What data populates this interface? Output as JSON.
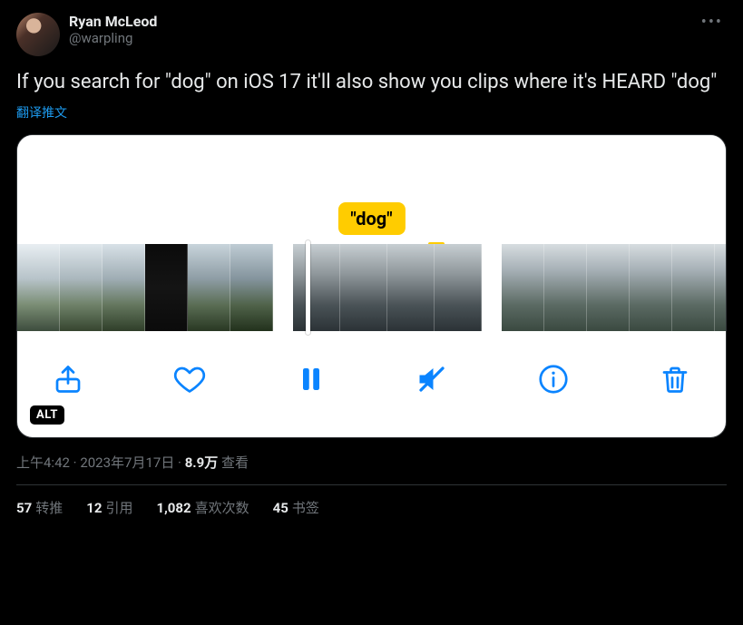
{
  "author": {
    "display_name": "Ryan McLeod",
    "username": "@warpling"
  },
  "tweet_text": "If you search for \"dog\" on iOS 17 it'll also show you clips where it's HEARD \"dog\"",
  "translate_label": "翻译推文",
  "media": {
    "bubble_text": "\"dog\"",
    "alt_badge": "ALT"
  },
  "timestamp": {
    "time": "上午4:42",
    "date": "2023年7月17日",
    "views_count": "8.9万",
    "views_label": "查看"
  },
  "stats": {
    "retweets_count": "57",
    "retweets_label": "转推",
    "quotes_count": "12",
    "quotes_label": "引用",
    "likes_count": "1,082",
    "likes_label": "喜欢次数",
    "bookmarks_count": "45",
    "bookmarks_label": "书签"
  }
}
